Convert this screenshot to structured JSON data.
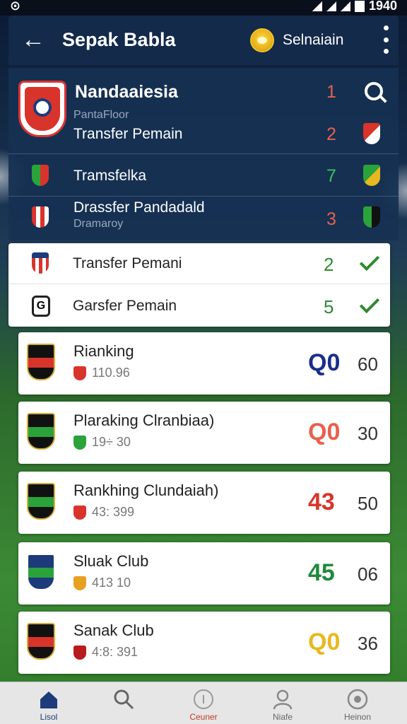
{
  "status_bar": {
    "left": "⊙",
    "time": "1940"
  },
  "app_bar": {
    "title": "Sepak Babla",
    "coin_label": "Selnaiain"
  },
  "dark_list": [
    {
      "label": "Nandaaiesia",
      "sub": "PantaFloor",
      "value": "1"
    },
    {
      "label": "Transfer Pemain",
      "value": "2"
    },
    {
      "label": "Tramsfelka",
      "value": "7"
    },
    {
      "label": "Drassfer Pandadald",
      "sub": "Dramaroy",
      "value": "3"
    }
  ],
  "white_list": [
    {
      "label": "Transfer Pemani",
      "value": "2"
    },
    {
      "label": "Garsfer Pemain",
      "value": "5"
    }
  ],
  "rankings": [
    {
      "name": "Rianking",
      "stat": "110.96",
      "score": "Q0",
      "pts": "60",
      "score_color": "#1a2e8a",
      "mini_color": "#d9342b"
    },
    {
      "name": "Plaraking Clranbiaa)",
      "stat": "19÷ 30",
      "score": "Q0",
      "pts": "30",
      "score_color": "#e8604c",
      "mini_color": "#2aa33a"
    },
    {
      "name": "Rankhing Clundaiah)",
      "stat": "43: 399",
      "score": "43",
      "pts": "50",
      "score_color": "#d9342b",
      "mini_color": "#d9342b"
    },
    {
      "name": "Sluak Club",
      "stat": "413 10",
      "score": "45",
      "pts": "06",
      "score_color": "#1f8a3a",
      "mini_color": "#e8a020"
    },
    {
      "name": "Sanak Club",
      "stat": "4:8: 391",
      "score": "Q0",
      "pts": "36",
      "score_color": "#e8b820",
      "mini_color": "#b81c1c"
    }
  ],
  "bottom_nav": [
    {
      "label": "Lisol"
    },
    {
      "label": ""
    },
    {
      "label": "Ceuner"
    },
    {
      "label": "Niafe"
    },
    {
      "label": "Heinon"
    }
  ],
  "colors": {
    "accent": "#132a4a",
    "positive": "#2f8a2f",
    "negative": "#e8604c"
  }
}
